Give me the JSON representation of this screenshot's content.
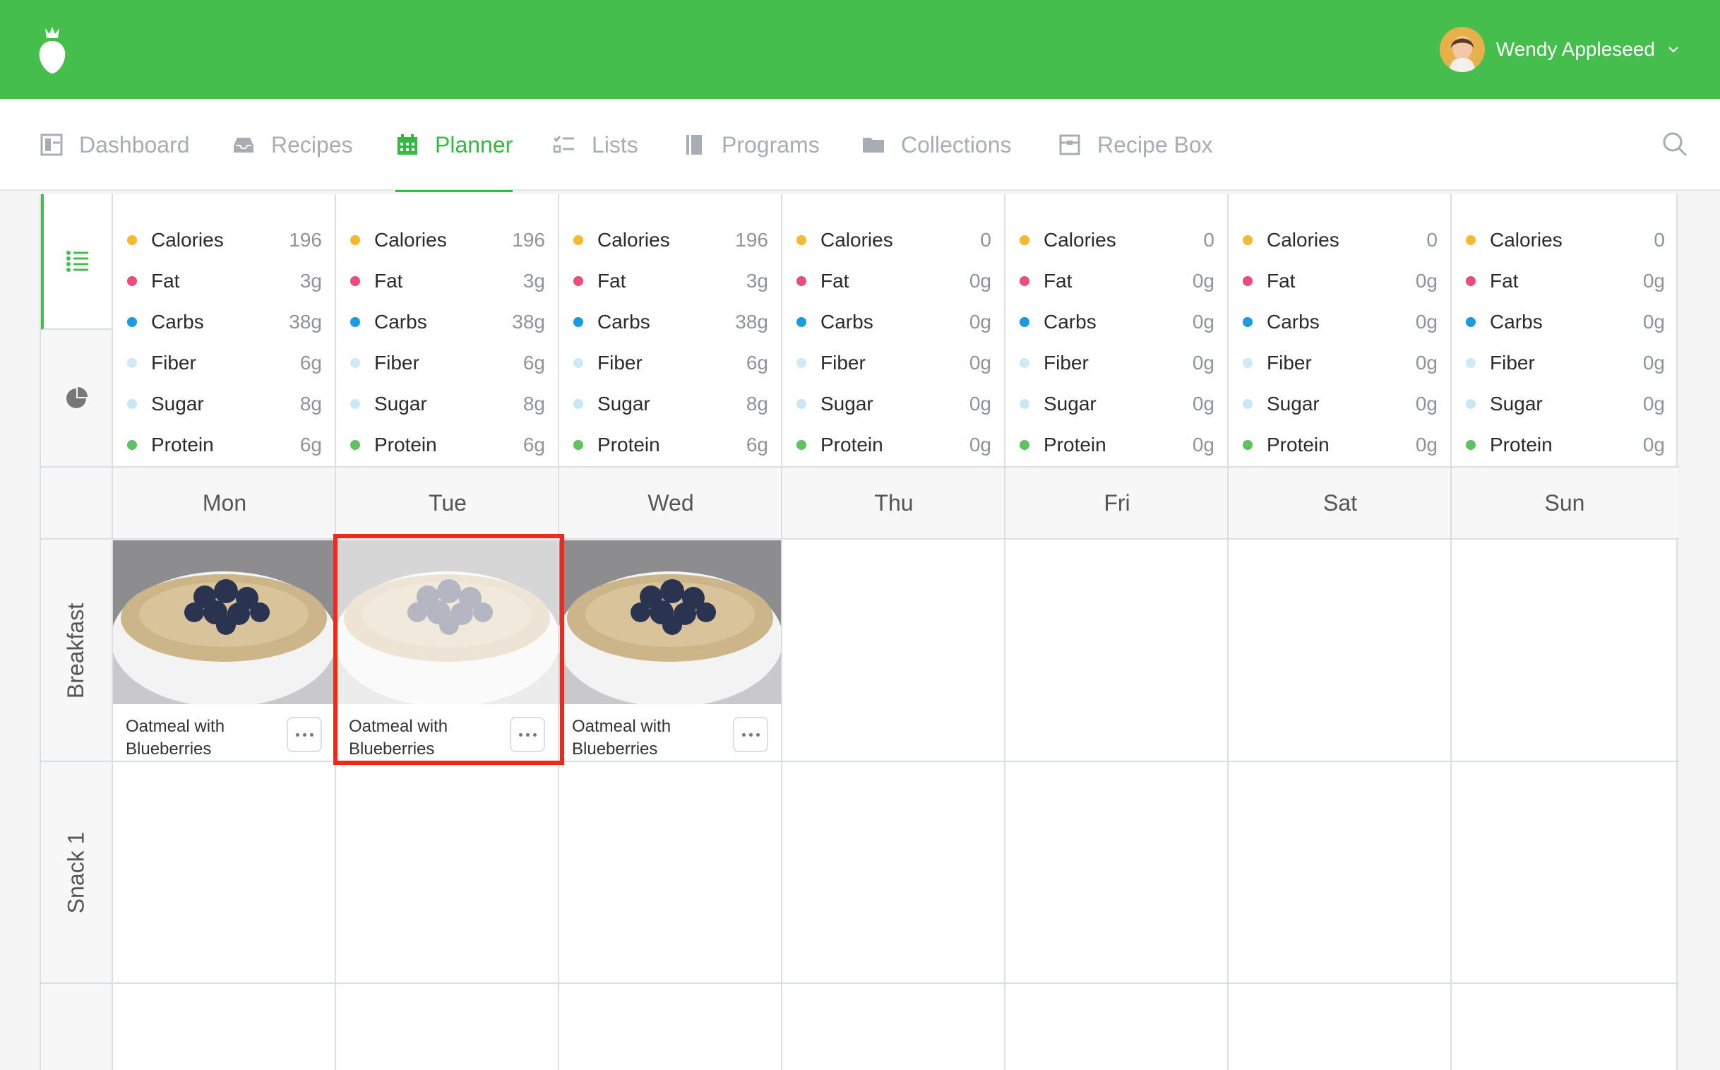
{
  "user": {
    "name": "Wendy Appleseed"
  },
  "nav": {
    "items": [
      {
        "label": "Dashboard",
        "icon": "dashboard-icon"
      },
      {
        "label": "Recipes",
        "icon": "inbox-icon"
      },
      {
        "label": "Planner",
        "icon": "calendar-icon",
        "active": true
      },
      {
        "label": "Lists",
        "icon": "checklist-icon"
      },
      {
        "label": "Programs",
        "icon": "book-icon"
      },
      {
        "label": "Collections",
        "icon": "folder-icon"
      },
      {
        "label": "Recipe Box",
        "icon": "box-icon"
      }
    ]
  },
  "nutrient_colors": {
    "Calories": "#f5b82e",
    "Fat": "#ec4b7c",
    "Carbs": "#1a9be2",
    "Fiber": "#cfe9f7",
    "Sugar": "#cbe7f6",
    "Protein": "#5cc35e"
  },
  "nutrition": [
    {
      "Calories": "196",
      "Fat": "3g",
      "Carbs": "38g",
      "Fiber": "6g",
      "Sugar": "8g",
      "Protein": "6g"
    },
    {
      "Calories": "196",
      "Fat": "3g",
      "Carbs": "38g",
      "Fiber": "6g",
      "Sugar": "8g",
      "Protein": "6g"
    },
    {
      "Calories": "196",
      "Fat": "3g",
      "Carbs": "38g",
      "Fiber": "6g",
      "Sugar": "8g",
      "Protein": "6g"
    },
    {
      "Calories": "0",
      "Fat": "0g",
      "Carbs": "0g",
      "Fiber": "0g",
      "Sugar": "0g",
      "Protein": "0g"
    },
    {
      "Calories": "0",
      "Fat": "0g",
      "Carbs": "0g",
      "Fiber": "0g",
      "Sugar": "0g",
      "Protein": "0g"
    },
    {
      "Calories": "0",
      "Fat": "0g",
      "Carbs": "0g",
      "Fiber": "0g",
      "Sugar": "0g",
      "Protein": "0g"
    },
    {
      "Calories": "0",
      "Fat": "0g",
      "Carbs": "0g",
      "Fiber": "0g",
      "Sugar": "0g",
      "Protein": "0g"
    }
  ],
  "days": [
    "Mon",
    "Tue",
    "Wed",
    "Thu",
    "Fri",
    "Sat",
    "Sun"
  ],
  "meals": [
    "Breakfast",
    "Snack 1"
  ],
  "cards": [
    {
      "day": "Mon",
      "title": "Oatmeal with Blueberries"
    },
    {
      "day": "Tue",
      "title": "Oatmeal with Blueberries",
      "state": "dragging"
    },
    {
      "day": "Wed",
      "title": "Oatmeal with Blueberries"
    }
  ]
}
